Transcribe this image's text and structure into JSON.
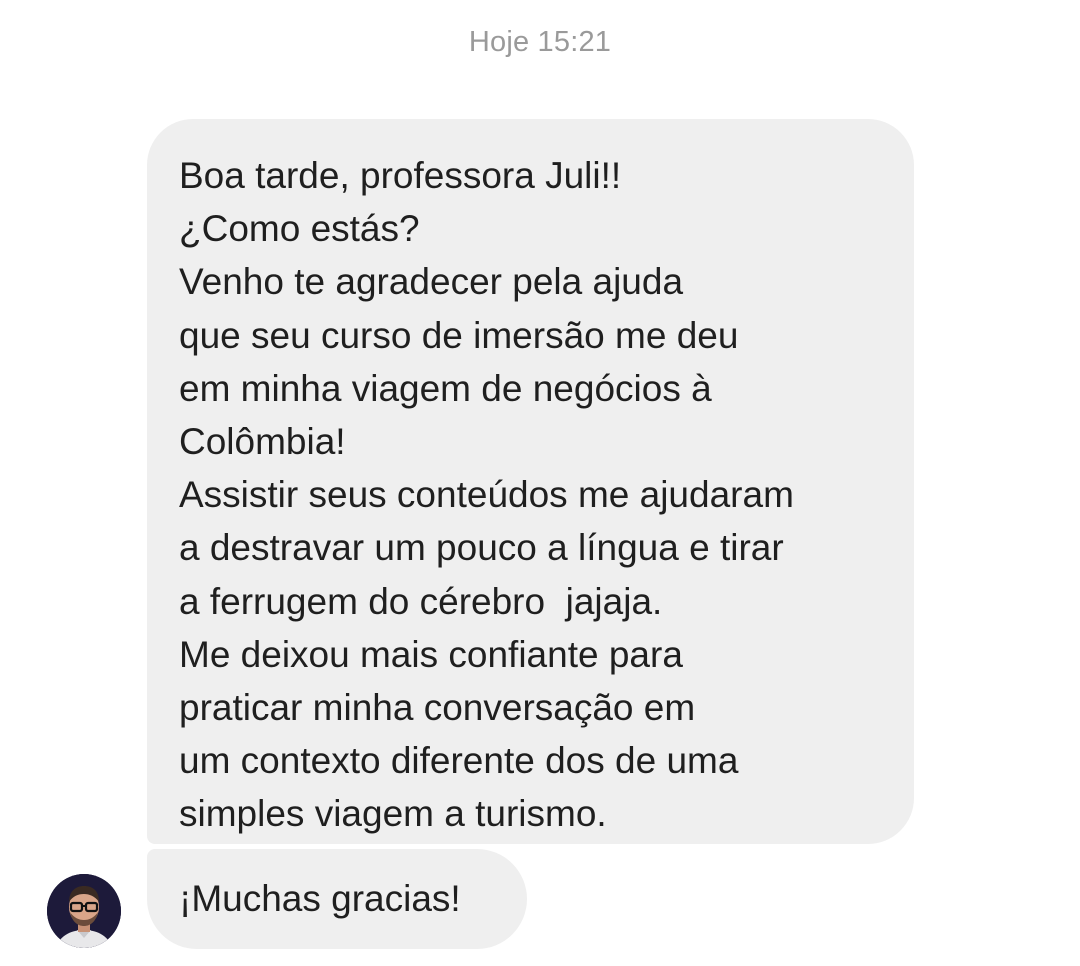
{
  "conversation": {
    "timestamp": "Hoje 15:21",
    "messages": [
      {
        "lines": [
          "Boa tarde, professora Juli!!",
          "¿Como estás?",
          "Venho te agradecer pela ajuda",
          "que seu curso de imersão me deu",
          "em minha viagem de negócios à",
          "Colômbia!",
          "Assistir seus conteúdos me ajudaram",
          "a destravar um pouco a língua e tirar",
          "a ferrugem do cérebro  jajaja.",
          "Me deixou mais confiante para",
          "praticar minha conversação em",
          "um contexto diferente dos de uma",
          "simples viagem a turismo."
        ]
      },
      {
        "text": "¡Muchas gracias!"
      }
    ],
    "sender": {
      "avatar_icon": "person-avatar-icon"
    }
  },
  "colors": {
    "bubble_background": "#efefef",
    "text": "#1f1f1f",
    "timestamp": "#9a9a9a",
    "background": "#ffffff"
  }
}
